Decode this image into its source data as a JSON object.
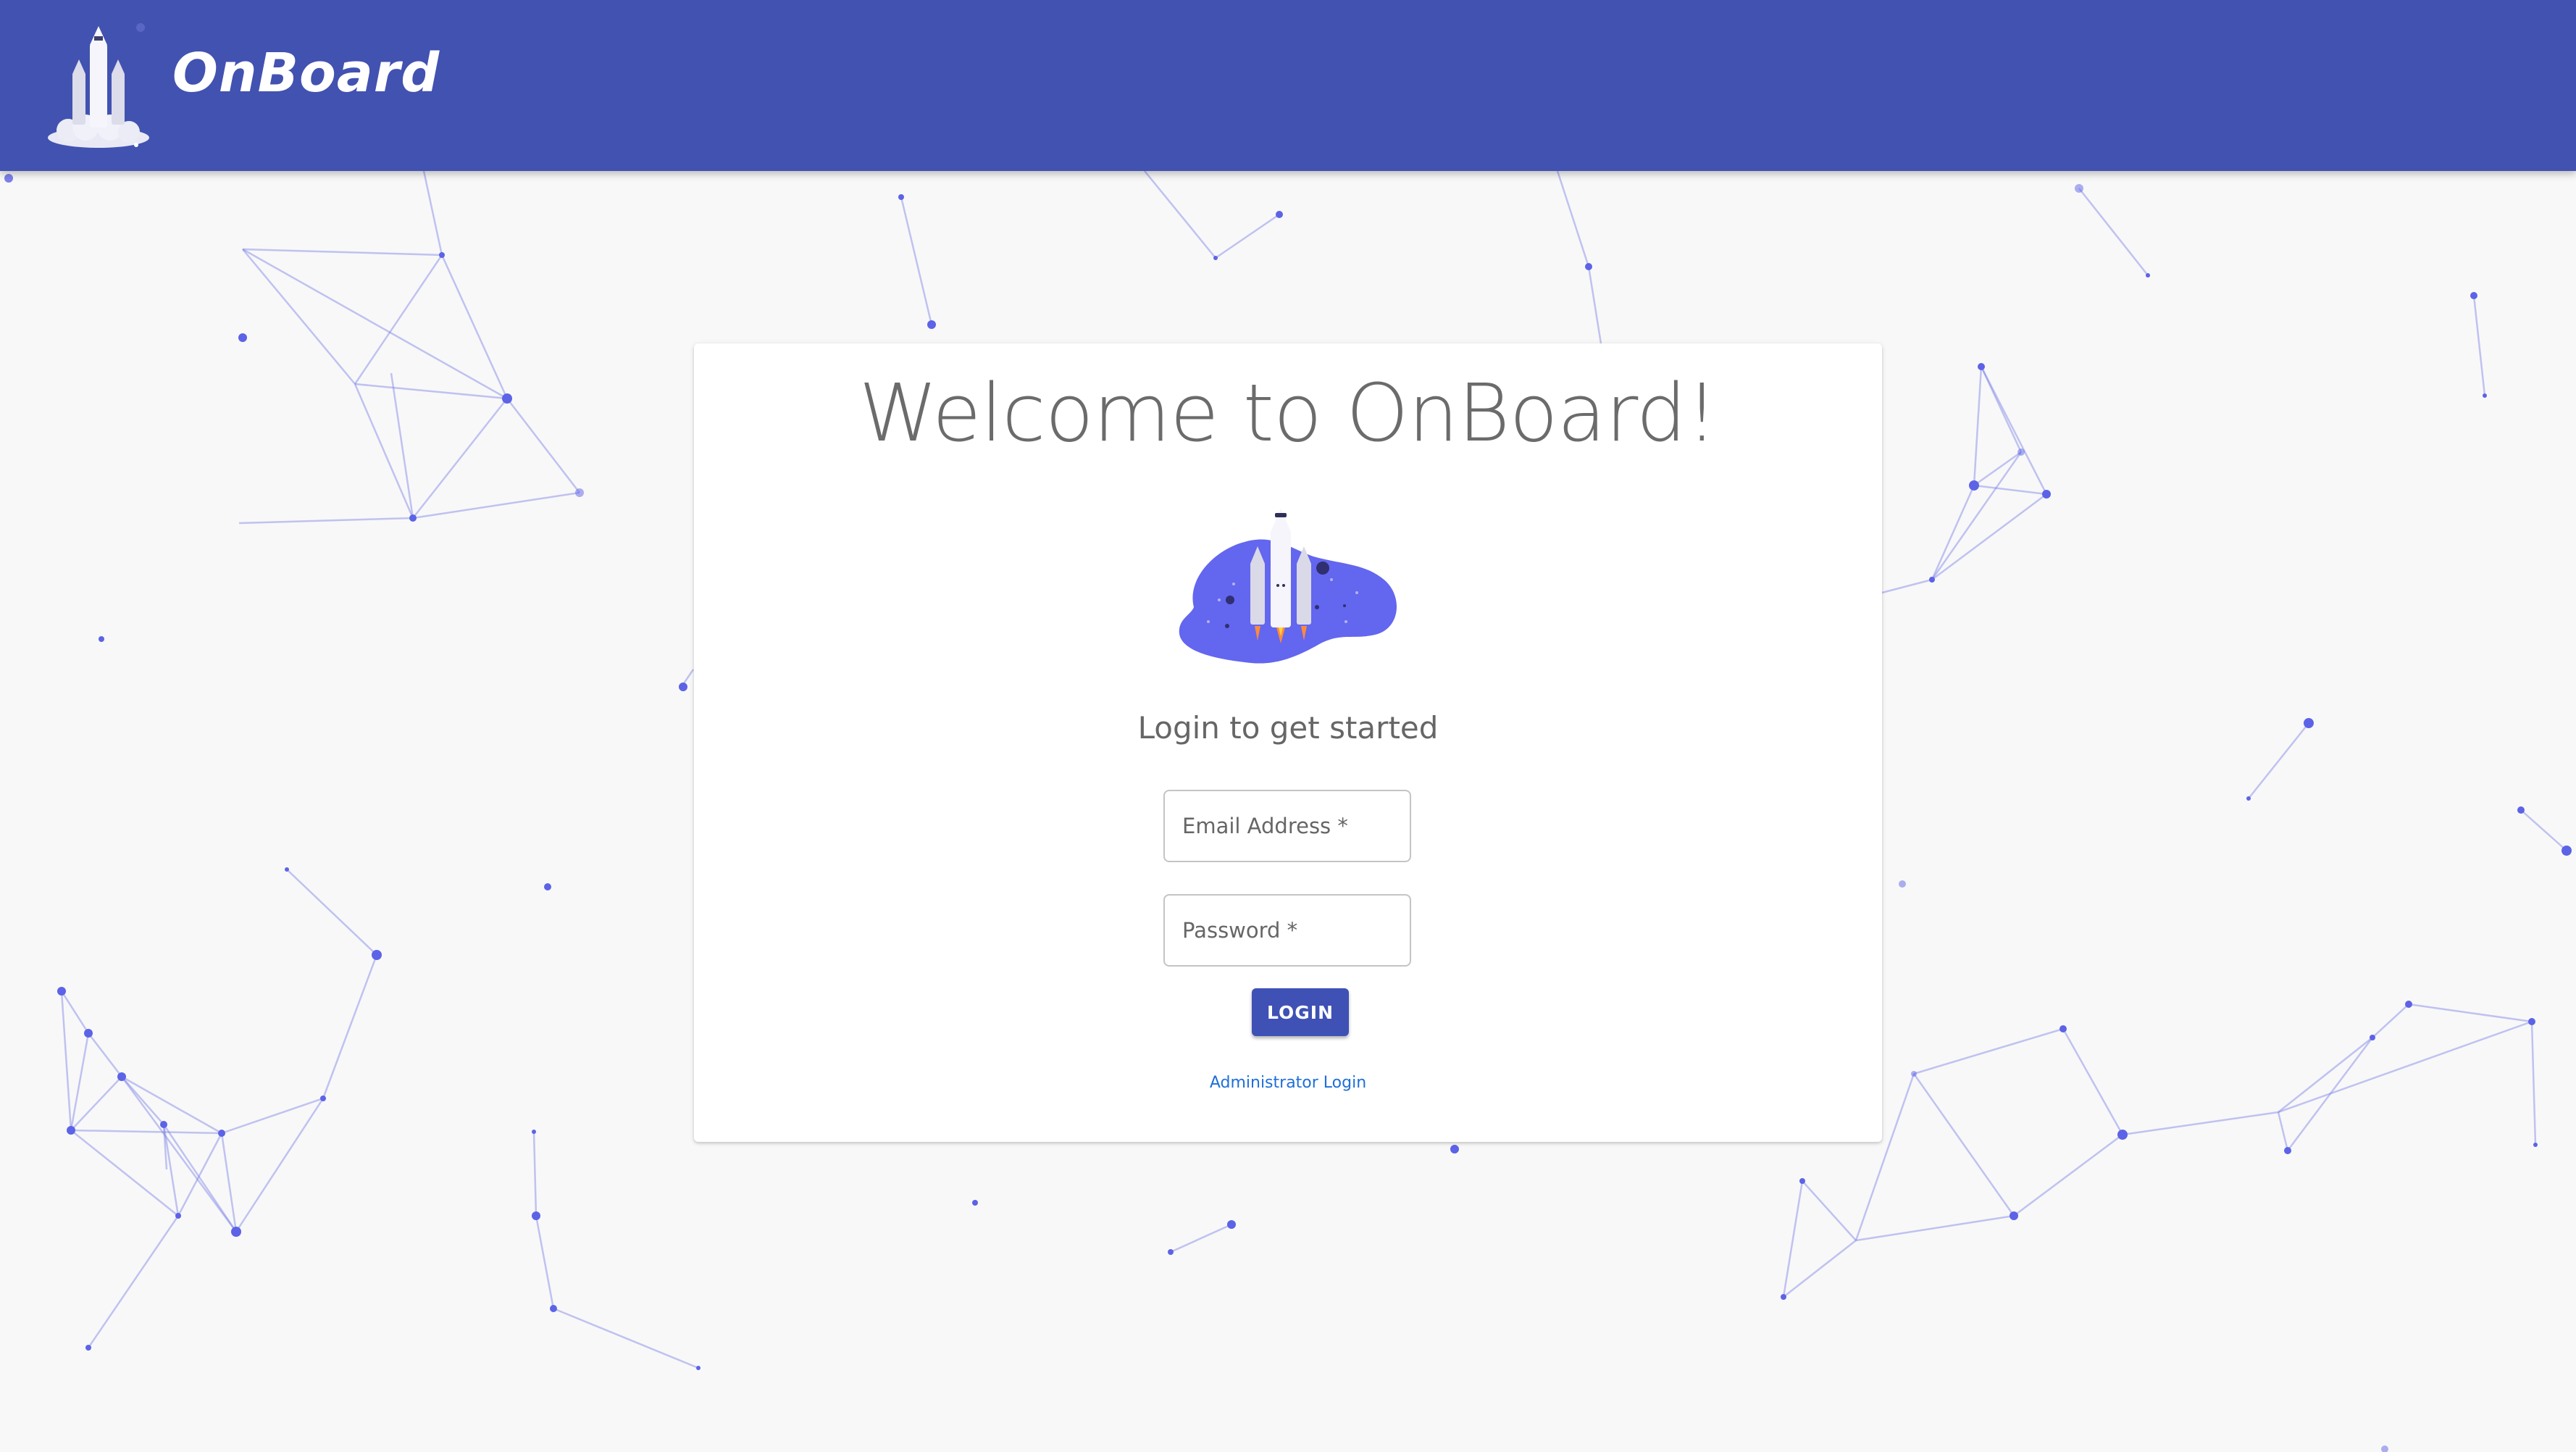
{
  "header": {
    "brand_name": "OnBoard",
    "logo_icon": "rocket-launch-icon",
    "background_color": "#4252b1"
  },
  "card": {
    "title": "Welcome to OnBoard!",
    "hero_icon": "rocket-blob-illustration",
    "subtitle": "Login to get started",
    "email": {
      "placeholder": "Email Address *",
      "value": ""
    },
    "password": {
      "placeholder": "Password *",
      "value": ""
    },
    "login_label": "LOGIN",
    "admin_link_label": "Administrator Login"
  },
  "colors": {
    "accent": "#3f51b5",
    "network_nodes": "#5c63e6",
    "link": "#1e6fd9",
    "page_background": "#f8f8f8"
  }
}
